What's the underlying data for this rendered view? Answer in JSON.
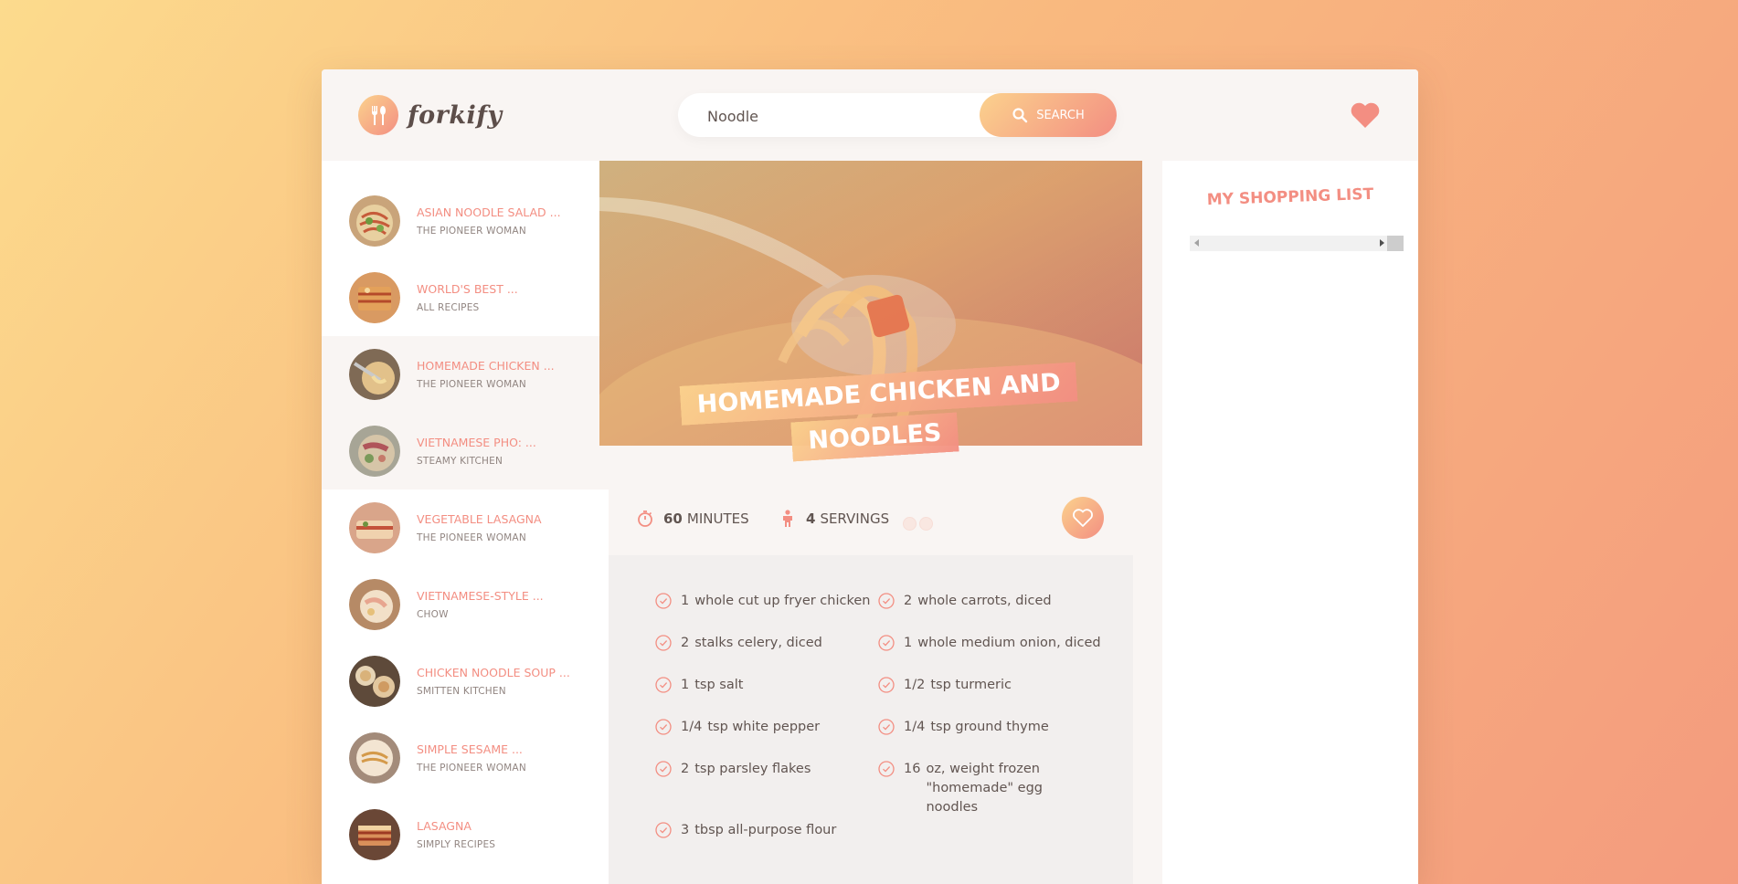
{
  "header": {
    "logo_text": "forkify",
    "search_value": "Noodle",
    "search_button": "Search"
  },
  "results": [
    {
      "title": "Asian Noodle Salad ...",
      "publisher": "The Pioneer Woman"
    },
    {
      "title": "World's Best ...",
      "publisher": "All Recipes"
    },
    {
      "title": "Homemade Chicken ...",
      "publisher": "The Pioneer Woman"
    },
    {
      "title": "Vietnamese Pho: ...",
      "publisher": "Steamy Kitchen"
    },
    {
      "title": "Vegetable Lasagna",
      "publisher": "The Pioneer Woman"
    },
    {
      "title": "Vietnamese-Style ...",
      "publisher": "Chow"
    },
    {
      "title": "Chicken Noodle Soup ...",
      "publisher": "Smitten Kitchen"
    },
    {
      "title": "Simple Sesame ...",
      "publisher": "The Pioneer Woman"
    },
    {
      "title": "Lasagna",
      "publisher": "Simply Recipes"
    }
  ],
  "recipe": {
    "title": "Homemade Chicken and Noodles",
    "minutes": "60",
    "minutes_label": "Minutes",
    "servings": "4",
    "servings_label": "Servings",
    "ingredients": [
      {
        "qty": "1",
        "text": "whole cut up fryer chicken"
      },
      {
        "qty": "2",
        "text": "whole carrots, diced"
      },
      {
        "qty": "2",
        "text": "stalks celery, diced"
      },
      {
        "qty": "1",
        "text": "whole medium onion, diced"
      },
      {
        "qty": "1",
        "text": "tsp salt"
      },
      {
        "qty": "1/2",
        "text": "tsp turmeric"
      },
      {
        "qty": "1/4",
        "text": "tsp white pepper"
      },
      {
        "qty": "1/4",
        "text": "tsp ground thyme"
      },
      {
        "qty": "2",
        "text": "tsp parsley flakes"
      },
      {
        "qty": "16",
        "text": "oz, weight frozen \"homemade\" egg noodles"
      },
      {
        "qty": "3",
        "text": "tbsp all-purpose flour"
      }
    ]
  },
  "shopping": {
    "title": "My Shopping List"
  },
  "colors": {
    "accent": "#f38e82",
    "accent_light": "#fbd28d",
    "text": "#615551",
    "panel": "#f9f5f3"
  }
}
